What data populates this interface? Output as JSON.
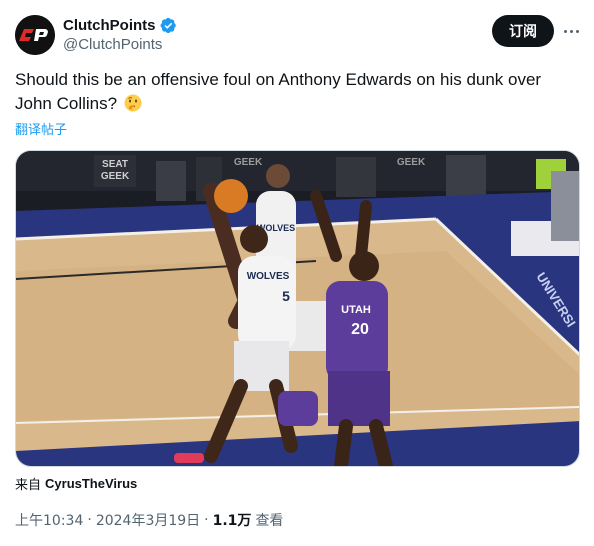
{
  "author": {
    "display_name": "ClutchPoints",
    "handle": "@ClutchPoints",
    "avatar_text": "CP",
    "verified": true
  },
  "actions": {
    "subscribe_label": "订阅",
    "more_icon": "more-horizontal-icon"
  },
  "tweet": {
    "text": "Should this be an offensive foul on Anthony Edwards on his dunk over John Collins?",
    "emoji": "thinking-face",
    "translate_label": "翻译帖子"
  },
  "media": {
    "court_signage_1": "SEAT",
    "court_signage_2": "GEEK",
    "court_signage_3": "GEEK",
    "court_signage_4": "GEEK",
    "court_floor_text": "UNIVERSI",
    "player_a_jersey_team": "WOLVES",
    "player_a_jersey_number": "5",
    "player_b_jersey_team": "WOLVES",
    "player_c_jersey_team": "UTAH",
    "player_c_jersey_number": "20"
  },
  "attribution": {
    "prefix": "来自",
    "user": "CyrusTheVirus"
  },
  "meta": {
    "time": "上午10:34",
    "separator": "·",
    "date": "2024年3月19日",
    "separator2": "·",
    "views_count": "1.1万",
    "views_label": "查看"
  },
  "colors": {
    "verified": "#1d9bf0",
    "link": "#1d9bf0",
    "court_wood": "#d9b98c",
    "court_paint_blue": "#2a3580",
    "utah_purple": "#5c3d9b"
  }
}
